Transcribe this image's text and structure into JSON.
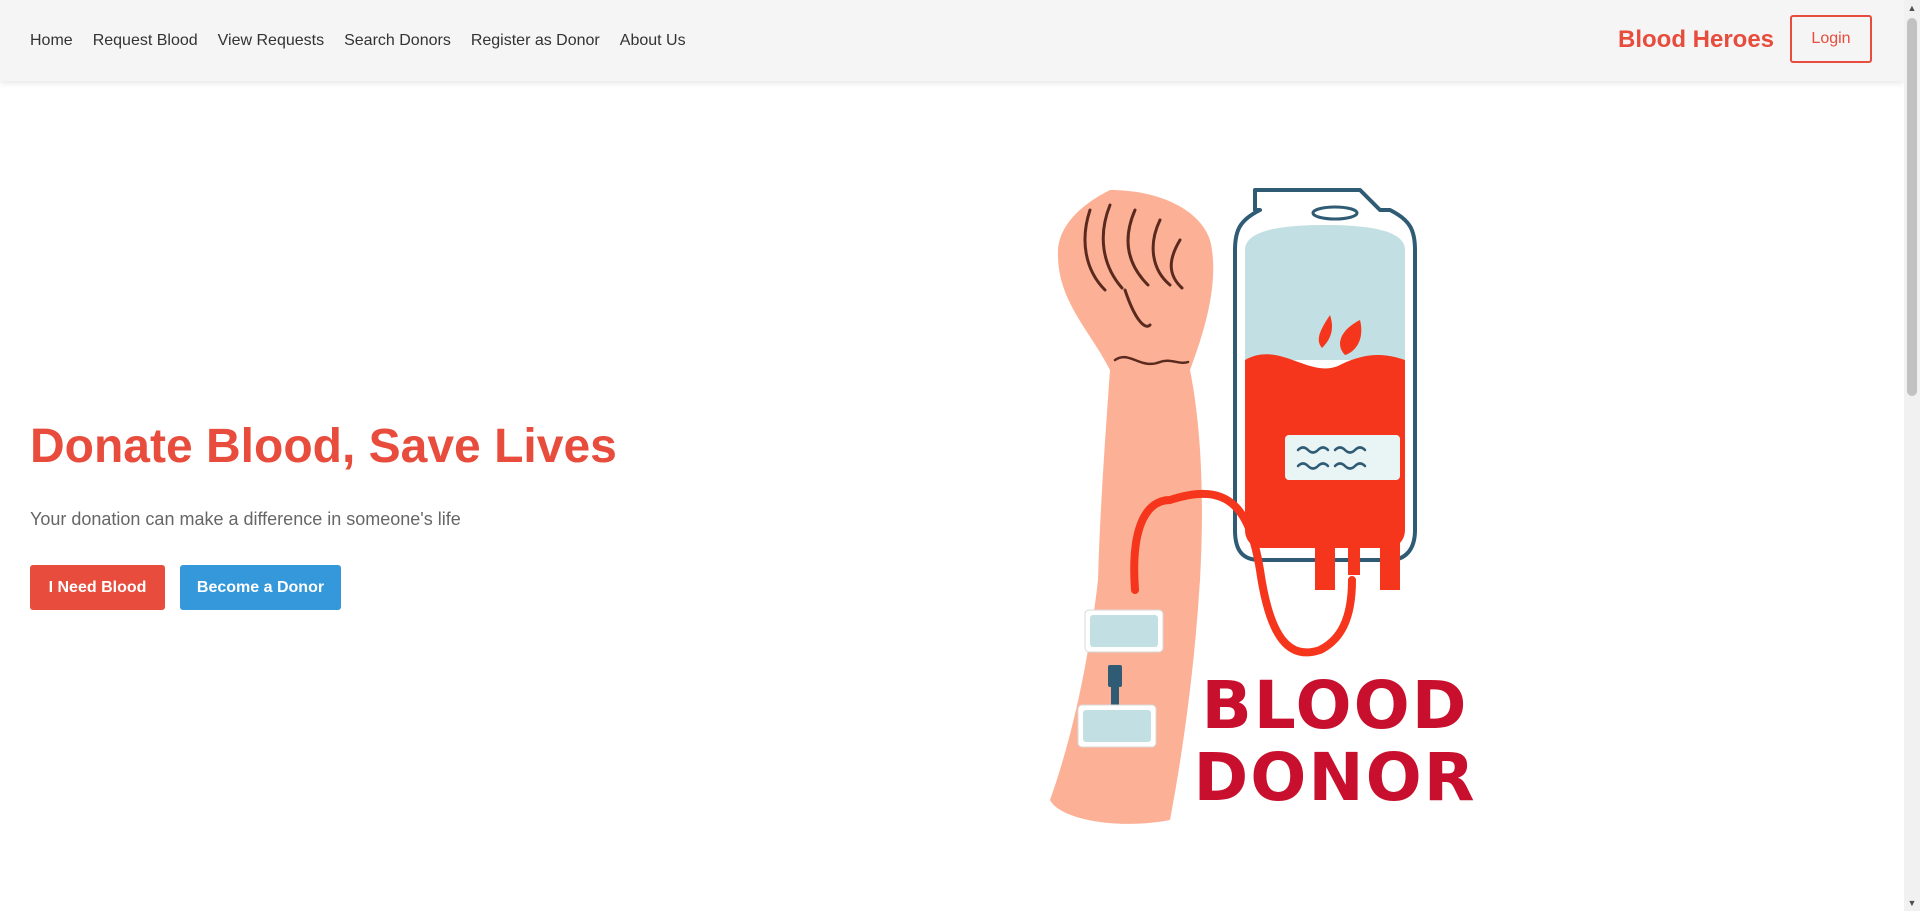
{
  "nav": {
    "links": [
      {
        "label": "Home"
      },
      {
        "label": "Request Blood"
      },
      {
        "label": "View Requests"
      },
      {
        "label": "Search Donors"
      },
      {
        "label": "Register as Donor"
      },
      {
        "label": "About Us"
      }
    ],
    "brand": "Blood Heroes",
    "login_label": "Login"
  },
  "hero": {
    "title": "Donate Blood, Save Lives",
    "subtitle": "Your donation can make a difference in someone's life",
    "need_blood_label": "I Need Blood",
    "become_donor_label": "Become a Donor"
  },
  "illustration": {
    "line1": "BLOOD",
    "line2": "DONOR"
  },
  "colors": {
    "accent": "#e74c3c",
    "secondary": "#3498db",
    "navbar_bg": "#f5f5f5",
    "illustration_red": "#c8102e"
  },
  "icons": {
    "scroll_up": "scroll-up-arrow-icon",
    "scroll_down": "scroll-down-arrow-icon",
    "illustration": "blood-donation-arm-and-bag-illustration"
  }
}
